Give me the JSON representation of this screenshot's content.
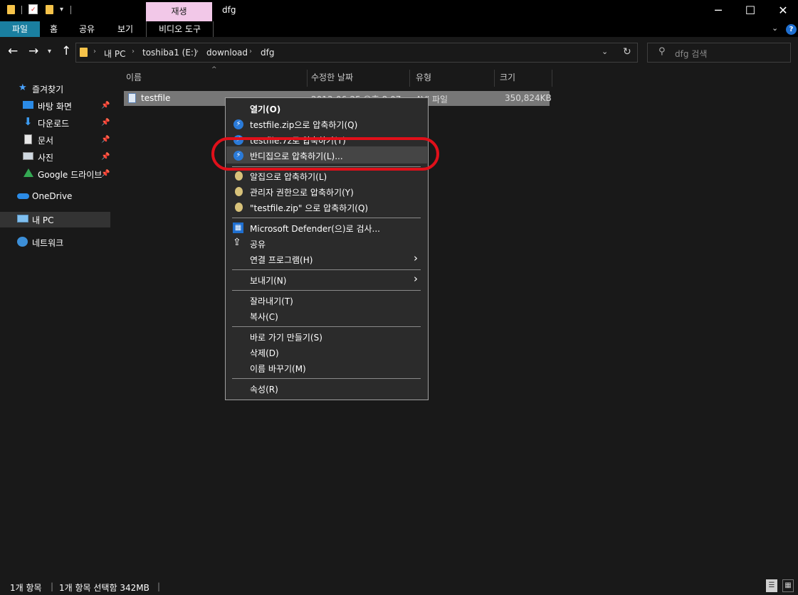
{
  "window": {
    "title": "dfg",
    "context_tab": "재생"
  },
  "ribbon": {
    "tabs": [
      "파일",
      "홈",
      "공유",
      "보기",
      "비디오 도구"
    ]
  },
  "address": {
    "crumbs": [
      "내 PC",
      "toshiba1 (E:)",
      "download",
      "dfg"
    ],
    "search_placeholder": "dfg 검색"
  },
  "sidebar": {
    "quick_access": "즐겨찾기",
    "items": [
      "바탕 화면",
      "다운로드",
      "문서",
      "사진",
      "Google 드라이브"
    ],
    "onedrive": "OneDrive",
    "this_pc": "내 PC",
    "network": "네트워크"
  },
  "columns": {
    "name": "이름",
    "date": "수정한 날짜",
    "type": "유형",
    "size": "크기"
  },
  "file": {
    "name": "testfile",
    "date": "2013-06-25 오후 8:07",
    "type": "AVI 파일",
    "size": "350,824KB"
  },
  "context_menu": {
    "open": "열기(O)",
    "zip": "testfile.zip으로 압축하기(Q)",
    "sevenz": "testfile.7z로 압축하기(T)",
    "bandizip": "반디집으로 압축하기(L)...",
    "alzip": "알집으로 압축하기(L)",
    "admin": "관리자 권한으로 압축하기(Y)",
    "quickzip": "\"testfile.zip\" 으로 압축하기(Q)",
    "defender": "Microsoft Defender(으)로 검사...",
    "share": "공유",
    "open_with": "연결 프로그램(H)",
    "send_to": "보내기(N)",
    "cut": "잘라내기(T)",
    "copy": "복사(C)",
    "shortcut": "바로 가기 만들기(S)",
    "delete": "삭제(D)",
    "rename": "이름 바꾸기(M)",
    "properties": "속성(R)"
  },
  "status": {
    "count": "1개 항목",
    "selected": "1개 항목 선택함 342MB"
  },
  "colors": {
    "accent": "#1a7fa0",
    "highlight_ring": "#e0101a",
    "context_tab": "#f2c8e8"
  }
}
